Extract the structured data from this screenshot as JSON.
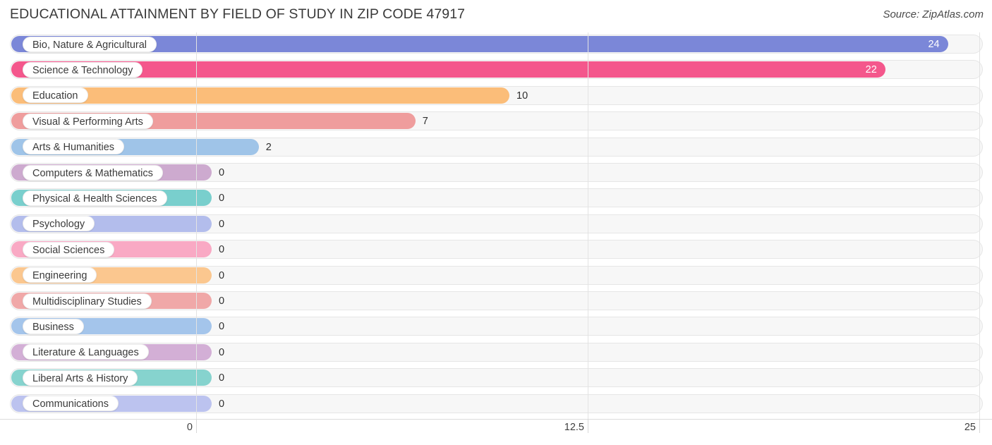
{
  "header": {
    "title": "EDUCATIONAL ATTAINMENT BY FIELD OF STUDY IN ZIP CODE 47917",
    "source": "Source: ZipAtlas.com"
  },
  "chart_data": {
    "type": "bar",
    "orientation": "horizontal",
    "title": "EDUCATIONAL ATTAINMENT BY FIELD OF STUDY IN ZIP CODE 47917",
    "xlabel": "",
    "ylabel": "",
    "xlim": [
      0,
      25
    ],
    "grid": true,
    "legend": "none",
    "xticks": [
      "0",
      "12.5",
      "25"
    ],
    "xtick_values": [
      0,
      12.5,
      25
    ],
    "categories": [
      "Bio, Nature & Agricultural",
      "Science & Technology",
      "Education",
      "Visual & Performing Arts",
      "Arts & Humanities",
      "Computers & Mathematics",
      "Physical & Health Sciences",
      "Psychology",
      "Social Sciences",
      "Engineering",
      "Multidisciplinary Studies",
      "Business",
      "Literature & Languages",
      "Liberal Arts & History",
      "Communications"
    ],
    "values": [
      24,
      22,
      10,
      7,
      2,
      0,
      0,
      0,
      0,
      0,
      0,
      0,
      0,
      0,
      0
    ],
    "value_labels": [
      "24",
      "22",
      "10",
      "7",
      "2",
      "0",
      "0",
      "0",
      "0",
      "0",
      "0",
      "0",
      "0",
      "0",
      "0"
    ],
    "colors": [
      "#7b87d8",
      "#f4578c",
      "#fbbd79",
      "#ef9d9d",
      "#9fc4e8",
      "#cdaacf",
      "#79cfcd",
      "#b3bdec",
      "#f9a9c4",
      "#fbc78f",
      "#f0a8a8",
      "#a4c5eb",
      "#d3afd6",
      "#86d3ce",
      "#bcc3ef"
    ]
  }
}
